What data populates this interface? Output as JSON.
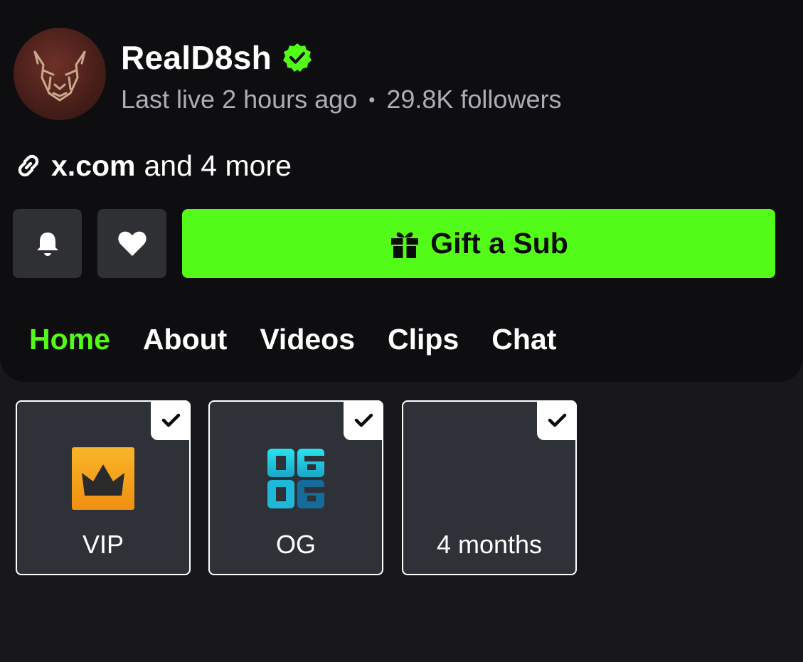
{
  "channel": {
    "name": "RealD8sh",
    "verified": true,
    "last_live": "Last live 2 hours ago",
    "separator": "•",
    "followers": "29.8K followers",
    "avatar_icon": "cheetah-logo-icon"
  },
  "links": {
    "icon": "link-icon",
    "domain": "x.com",
    "more": "and 4 more"
  },
  "actions": {
    "bell_icon": "bell-icon",
    "heart_icon": "heart-icon",
    "gift_icon": "gift-icon",
    "gift_label": "Gift a Sub"
  },
  "tabs": [
    {
      "label": "Home",
      "active": true
    },
    {
      "label": "About",
      "active": false
    },
    {
      "label": "Videos",
      "active": false
    },
    {
      "label": "Clips",
      "active": false
    },
    {
      "label": "Chat",
      "active": false
    }
  ],
  "badges": [
    {
      "label": "VIP",
      "icon": "vip-crown-icon",
      "checked": true
    },
    {
      "label": "OG",
      "icon": "og-badge-icon",
      "checked": true
    },
    {
      "label": "4 months",
      "icon": "",
      "checked": true
    }
  ],
  "colors": {
    "accent": "#53fc18",
    "background": "#18181b",
    "card": "#0e0e10",
    "button_dark": "#2f3034",
    "muted_text": "#adadb8",
    "vip_gold": "#f5a31a",
    "og_cyan": "#1fd4e0"
  }
}
